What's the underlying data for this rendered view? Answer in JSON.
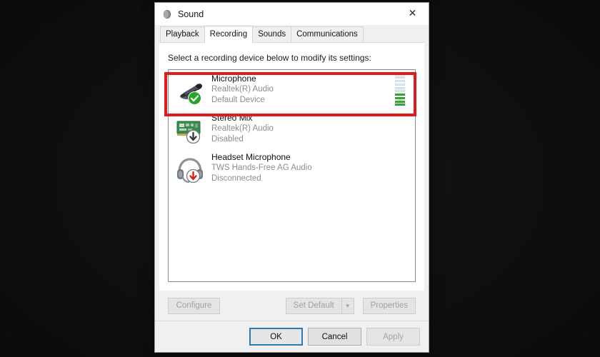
{
  "window": {
    "title": "Sound",
    "icon": "sound-speaker-icon",
    "close_label": "✕"
  },
  "tabs": [
    {
      "label": "Playback",
      "active": false
    },
    {
      "label": "Recording",
      "active": true
    },
    {
      "label": "Sounds",
      "active": false
    },
    {
      "label": "Communications",
      "active": false
    }
  ],
  "page": {
    "hint": "Select a recording device below to modify its settings:"
  },
  "devices": [
    {
      "name": "Microphone",
      "driver": "Realtek(R) Audio",
      "status": "Default Device",
      "icon": "desktop-microphone-icon",
      "badge": "green-check-badge",
      "highlighted": true,
      "meter_total": 10,
      "meter_active": 4
    },
    {
      "name": "Stereo Mix",
      "driver": "Realtek(R) Audio",
      "status": "Disabled",
      "icon": "sound-card-icon",
      "badge": "grey-down-arrow-badge",
      "highlighted": false,
      "meter_total": 0,
      "meter_active": 0
    },
    {
      "name": "Headset Microphone",
      "driver": "TWS Hands-Free AG Audio",
      "status": "Disconnected",
      "icon": "headset-icon",
      "badge": "red-down-arrow-badge",
      "highlighted": false,
      "meter_total": 0,
      "meter_active": 0
    }
  ],
  "actions": {
    "configure": "Configure",
    "set_default": "Set Default",
    "set_default_arrow": "▼",
    "properties": "Properties"
  },
  "commit": {
    "ok": "OK",
    "cancel": "Cancel",
    "apply": "Apply"
  },
  "colors": {
    "accent_focus": "#2d7ab5",
    "highlight_red": "#e01b1b",
    "meter_green": "#36b436",
    "badge_green": "#27a327",
    "badge_red": "#d82020",
    "badge_grey": "#6f6f6f"
  }
}
